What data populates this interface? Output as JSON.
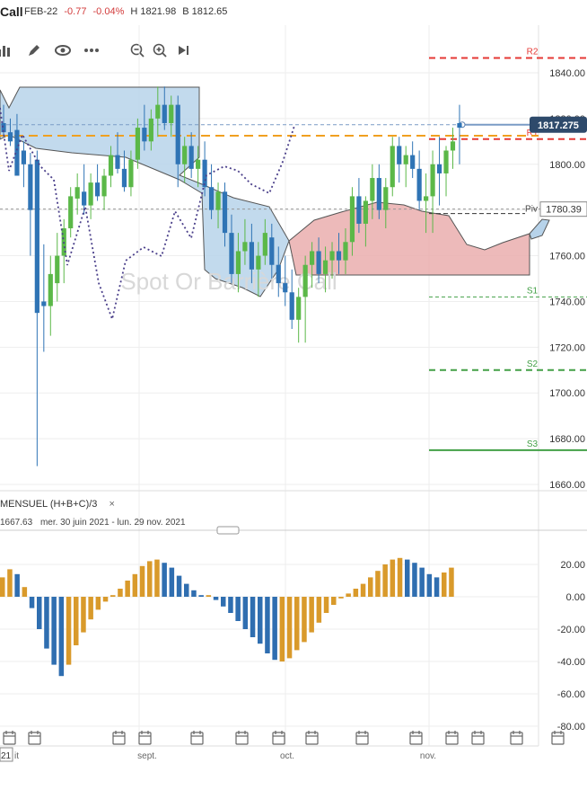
{
  "header": {
    "symbol": "Call",
    "contract": "FEB-22",
    "change": "-0.77",
    "change_pct": "-0.04%",
    "high": "H 1821.98",
    "bid": "B 1812.65"
  },
  "toolbar": {
    "icons": [
      "bar-chart-icon",
      "pencil-icon",
      "eye-icon",
      "more-icon",
      "zoom-out-icon",
      "zoom-in-icon",
      "play-icon"
    ]
  },
  "watermark": "Spot Or Barrière Call",
  "price_axis": {
    "ticks": [
      "1840.00",
      "1820.00",
      "1800.00",
      "1780.00",
      "1760.00",
      "1740.00",
      "1720.00",
      "1700.00",
      "1680.00",
      "1660.00"
    ],
    "last_price": "1817.275",
    "pivot_value": "1780.39"
  },
  "levels": {
    "r2": {
      "label": "R2",
      "value": 1846.5,
      "color": "#e53935"
    },
    "r1": {
      "label": "R1",
      "value": 1811,
      "color": "#e53935"
    },
    "pivot": {
      "label": "Piv",
      "value": 1780.39,
      "color": "#444444"
    },
    "s1": {
      "label": "S1",
      "value": 1742,
      "color": "#43a047"
    },
    "s2": {
      "label": "S2",
      "value": 1710,
      "color": "#43a047"
    },
    "s3": {
      "label": "S3",
      "value": 1675,
      "color": "#43a047"
    },
    "orange_line": 1812.5,
    "last_line": 1817.3
  },
  "indicator": {
    "title": "MENSUEL (H+B+C)/3",
    "close_label": "×",
    "subtitle_value": "1667.63",
    "subtitle_range": "mer. 30 juin 2021 - lun. 29 nov. 2021",
    "ticks": [
      "20.00",
      "0.00",
      "-20.00",
      "-40.00",
      "-60.00",
      "-80.00"
    ]
  },
  "time_axis": {
    "labels": [
      "21",
      "it",
      "sept.",
      "oct.",
      "nov."
    ]
  },
  "chart_data": {
    "type": "candlestick",
    "ylim": [
      1652,
      1852
    ],
    "colors": {
      "up": "#5bb848",
      "down": "#2f74b5"
    },
    "candles": [
      [
        1818,
        1826,
        1812,
        1814
      ],
      [
        1814,
        1820,
        1808,
        1810
      ],
      [
        1815,
        1822,
        1800,
        1795
      ],
      [
        1806,
        1810,
        1790,
        1800
      ],
      [
        1800,
        1805,
        1760,
        1780
      ],
      [
        1802,
        1806,
        1668,
        1735
      ],
      [
        1740,
        1765,
        1718,
        1738
      ],
      [
        1738,
        1760,
        1725,
        1752
      ],
      [
        1748,
        1770,
        1740,
        1760
      ],
      [
        1760,
        1776,
        1748,
        1772
      ],
      [
        1772,
        1790,
        1768,
        1786
      ],
      [
        1785,
        1796,
        1778,
        1790
      ],
      [
        1788,
        1800,
        1778,
        1782
      ],
      [
        1782,
        1796,
        1776,
        1792
      ],
      [
        1792,
        1800,
        1784,
        1786
      ],
      [
        1786,
        1798,
        1780,
        1795
      ],
      [
        1795,
        1808,
        1790,
        1804
      ],
      [
        1804,
        1814,
        1796,
        1798
      ],
      [
        1798,
        1806,
        1788,
        1790
      ],
      [
        1790,
        1806,
        1786,
        1802
      ],
      [
        1802,
        1820,
        1798,
        1816
      ],
      [
        1816,
        1826,
        1806,
        1810
      ],
      [
        1810,
        1824,
        1806,
        1820
      ],
      [
        1820,
        1834,
        1812,
        1826
      ],
      [
        1826,
        1834,
        1815,
        1818
      ],
      [
        1818,
        1830,
        1812,
        1826
      ],
      [
        1826,
        1830,
        1790,
        1800
      ],
      [
        1800,
        1812,
        1792,
        1808
      ],
      [
        1808,
        1814,
        1794,
        1798
      ],
      [
        1798,
        1808,
        1790,
        1802
      ],
      [
        1802,
        1810,
        1786,
        1790
      ],
      [
        1790,
        1800,
        1776,
        1780
      ],
      [
        1780,
        1792,
        1772,
        1788
      ],
      [
        1788,
        1792,
        1764,
        1770
      ],
      [
        1770,
        1778,
        1748,
        1752
      ],
      [
        1752,
        1770,
        1744,
        1762
      ],
      [
        1762,
        1776,
        1756,
        1766
      ],
      [
        1766,
        1774,
        1748,
        1754
      ],
      [
        1754,
        1766,
        1742,
        1760
      ],
      [
        1760,
        1776,
        1756,
        1770
      ],
      [
        1768,
        1774,
        1750,
        1756
      ],
      [
        1756,
        1764,
        1742,
        1748
      ],
      [
        1748,
        1760,
        1738,
        1744
      ],
      [
        1744,
        1754,
        1728,
        1732
      ],
      [
        1732,
        1746,
        1722,
        1742
      ],
      [
        1742,
        1760,
        1722,
        1756
      ],
      [
        1756,
        1766,
        1746,
        1762
      ],
      [
        1762,
        1768,
        1748,
        1752
      ],
      [
        1752,
        1764,
        1744,
        1758
      ],
      [
        1758,
        1766,
        1750,
        1762
      ],
      [
        1762,
        1770,
        1752,
        1758
      ],
      [
        1758,
        1772,
        1752,
        1766
      ],
      [
        1766,
        1790,
        1760,
        1786
      ],
      [
        1786,
        1794,
        1770,
        1774
      ],
      [
        1774,
        1786,
        1764,
        1784
      ],
      [
        1784,
        1800,
        1776,
        1794
      ],
      [
        1794,
        1800,
        1776,
        1780
      ],
      [
        1780,
        1794,
        1772,
        1790
      ],
      [
        1790,
        1812,
        1786,
        1808
      ],
      [
        1808,
        1812,
        1792,
        1800
      ],
      [
        1800,
        1808,
        1790,
        1804
      ],
      [
        1804,
        1810,
        1794,
        1798
      ],
      [
        1798,
        1806,
        1780,
        1784
      ],
      [
        1784,
        1796,
        1770,
        1786
      ],
      [
        1786,
        1806,
        1770,
        1800
      ],
      [
        1800,
        1812,
        1782,
        1796
      ],
      [
        1796,
        1808,
        1786,
        1806
      ],
      [
        1806,
        1816,
        1798,
        1810
      ],
      [
        1818,
        1826,
        1800,
        1816
      ]
    ],
    "oscillator": [
      {
        "v": 12,
        "c": "o"
      },
      {
        "v": 17,
        "c": "o"
      },
      {
        "v": 14,
        "c": "b"
      },
      {
        "v": 6,
        "c": "o"
      },
      {
        "v": -7,
        "c": "b"
      },
      {
        "v": -20,
        "c": "b"
      },
      {
        "v": -32,
        "c": "b"
      },
      {
        "v": -42,
        "c": "b"
      },
      {
        "v": -49,
        "c": "b"
      },
      {
        "v": -42,
        "c": "o"
      },
      {
        "v": -30,
        "c": "o"
      },
      {
        "v": -22,
        "c": "o"
      },
      {
        "v": -14,
        "c": "o"
      },
      {
        "v": -8,
        "c": "o"
      },
      {
        "v": -3,
        "c": "o"
      },
      {
        "v": 1,
        "c": "o"
      },
      {
        "v": 5,
        "c": "o"
      },
      {
        "v": 10,
        "c": "o"
      },
      {
        "v": 14,
        "c": "o"
      },
      {
        "v": 19,
        "c": "o"
      },
      {
        "v": 22,
        "c": "o"
      },
      {
        "v": 23,
        "c": "o"
      },
      {
        "v": 21,
        "c": "b"
      },
      {
        "v": 18,
        "c": "b"
      },
      {
        "v": 13,
        "c": "b"
      },
      {
        "v": 8,
        "c": "b"
      },
      {
        "v": 4,
        "c": "b"
      },
      {
        "v": 1,
        "c": "b"
      },
      {
        "v": 1,
        "c": "o"
      },
      {
        "v": -2,
        "c": "b"
      },
      {
        "v": -6,
        "c": "b"
      },
      {
        "v": -10,
        "c": "b"
      },
      {
        "v": -15,
        "c": "b"
      },
      {
        "v": -20,
        "c": "b"
      },
      {
        "v": -25,
        "c": "b"
      },
      {
        "v": -29,
        "c": "b"
      },
      {
        "v": -35,
        "c": "b"
      },
      {
        "v": -39,
        "c": "b"
      },
      {
        "v": -40,
        "c": "o"
      },
      {
        "v": -38,
        "c": "o"
      },
      {
        "v": -33,
        "c": "o"
      },
      {
        "v": -28,
        "c": "o"
      },
      {
        "v": -22,
        "c": "o"
      },
      {
        "v": -16,
        "c": "o"
      },
      {
        "v": -10,
        "c": "o"
      },
      {
        "v": -5,
        "c": "o"
      },
      {
        "v": -1,
        "c": "o"
      },
      {
        "v": 2,
        "c": "o"
      },
      {
        "v": 5,
        "c": "o"
      },
      {
        "v": 8,
        "c": "o"
      },
      {
        "v": 12,
        "c": "o"
      },
      {
        "v": 16,
        "c": "o"
      },
      {
        "v": 20,
        "c": "o"
      },
      {
        "v": 23,
        "c": "o"
      },
      {
        "v": 24,
        "c": "o"
      },
      {
        "v": 23,
        "c": "b"
      },
      {
        "v": 21,
        "c": "b"
      },
      {
        "v": 18,
        "c": "b"
      },
      {
        "v": 14,
        "c": "b"
      },
      {
        "v": 12,
        "c": "b"
      },
      {
        "v": 15,
        "c": "o"
      },
      {
        "v": 18,
        "c": "o"
      }
    ],
    "oscillator_ylim": [
      -82,
      34
    ]
  }
}
